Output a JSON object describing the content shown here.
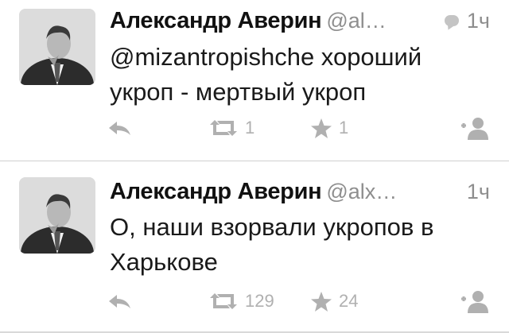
{
  "tweets": [
    {
      "author": "Александр Аверин",
      "handle": "@al…",
      "time": "1ч",
      "is_reply": true,
      "text": "@mizantropishche хороший укроп - мертвый укроп",
      "retweets": "1",
      "favorites": "1"
    },
    {
      "author": "Александр Аверин",
      "handle": "@alx…",
      "time": "1ч",
      "is_reply": false,
      "text": "О, наши взорвали укропов в Харькове",
      "retweets": "129",
      "favorites": "24"
    }
  ],
  "colors": {
    "text": "#1a1a1a",
    "muted": "#8e8e8e",
    "icon": "#b0b0b0",
    "divider": "#cfcfcf"
  },
  "icons": [
    "reply-icon",
    "retweet-icon",
    "favorite-icon",
    "follow-icon",
    "conversation-icon"
  ]
}
